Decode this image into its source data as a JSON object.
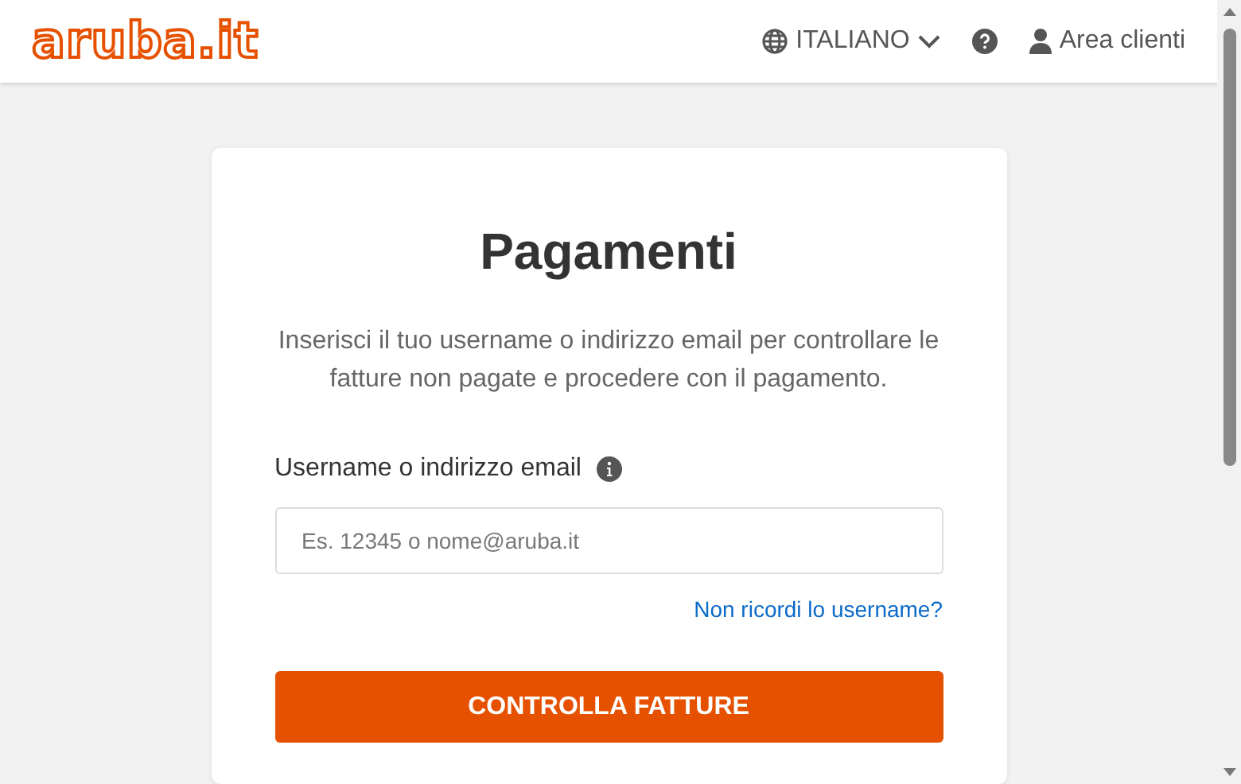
{
  "header": {
    "logo": "aruba.it",
    "language": "ITALIANO",
    "account": "Area clienti"
  },
  "card": {
    "title": "Pagamenti",
    "description": "Inserisci il tuo username o indirizzo email per controllare le fatture non pagate e procedere con il pagamento.",
    "field_label": "Username o indirizzo email",
    "placeholder": "Es. 12345 o nome@aruba.it",
    "link": "Non ricordi lo username?",
    "button": "CONTROLLA FATTURE"
  }
}
